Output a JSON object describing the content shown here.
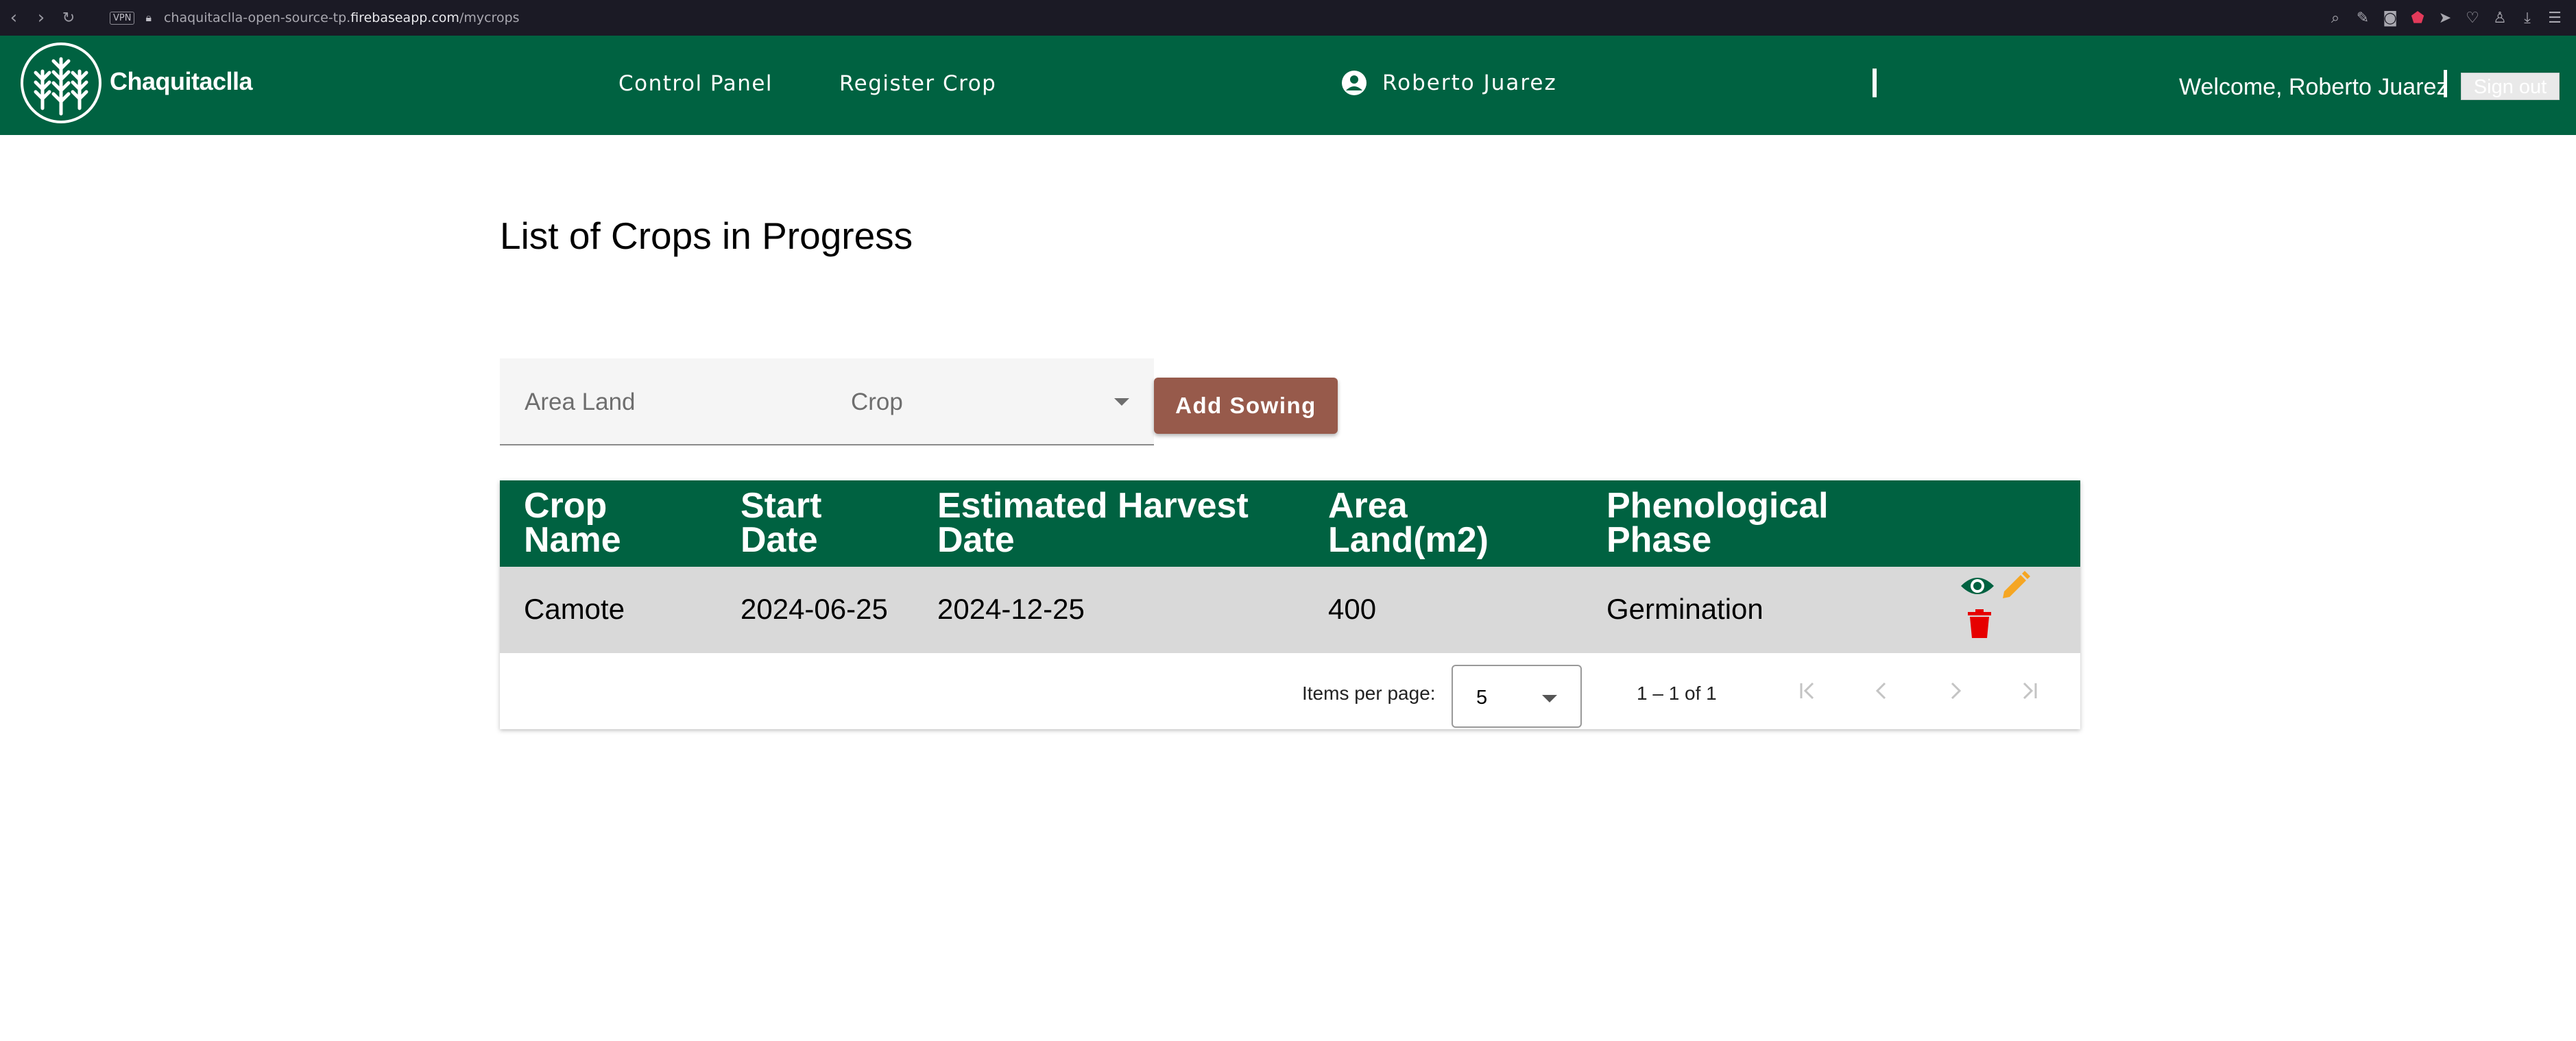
{
  "browser": {
    "vpn_label": "VPN",
    "url_prefix": "chaquitaclla-open-source-tp.",
    "url_domain": "firebaseapp.com",
    "url_path": "/mycrops",
    "icons": [
      "back-icon",
      "forward-icon",
      "reload-icon",
      "lock-icon",
      "search-icon",
      "edit-icon",
      "camera-icon",
      "shield-icon",
      "send-icon",
      "heart-icon",
      "profile-icon",
      "download-icon",
      "menu-icon"
    ]
  },
  "header": {
    "logo_text": "Chaquitaclla",
    "nav": [
      "Control Panel",
      "Register Crop"
    ],
    "user_name": "Roberto Juarez",
    "welcome": "Welcome, Roberto Juarez",
    "signout": "Sign out",
    "colors": {
      "brand": "#006241"
    }
  },
  "main": {
    "title": "List of Crops in Progress",
    "area_placeholder": "Area Land",
    "crop_placeholder": "Crop",
    "add_button": "Add Sowing",
    "add_button_color": "#975a4b"
  },
  "table": {
    "columns": [
      [
        "Crop",
        "Name"
      ],
      [
        "Start",
        "Date"
      ],
      [
        "Estimated Harvest",
        "Date"
      ],
      [
        "Area",
        "Land(m2)"
      ],
      [
        "Phenological",
        "Phase"
      ]
    ],
    "rows": [
      {
        "crop_name": "Camote",
        "start_date": "2024-06-25",
        "harvest_date": "2024-12-25",
        "area": "400",
        "phase": "Germination"
      }
    ],
    "actions": {
      "view_color": "#006241",
      "edit_color": "#f5a623",
      "delete_color": "#e60000"
    }
  },
  "paginator": {
    "label": "Items per page:",
    "page_size": "5",
    "range": "1 – 1 of 1"
  }
}
